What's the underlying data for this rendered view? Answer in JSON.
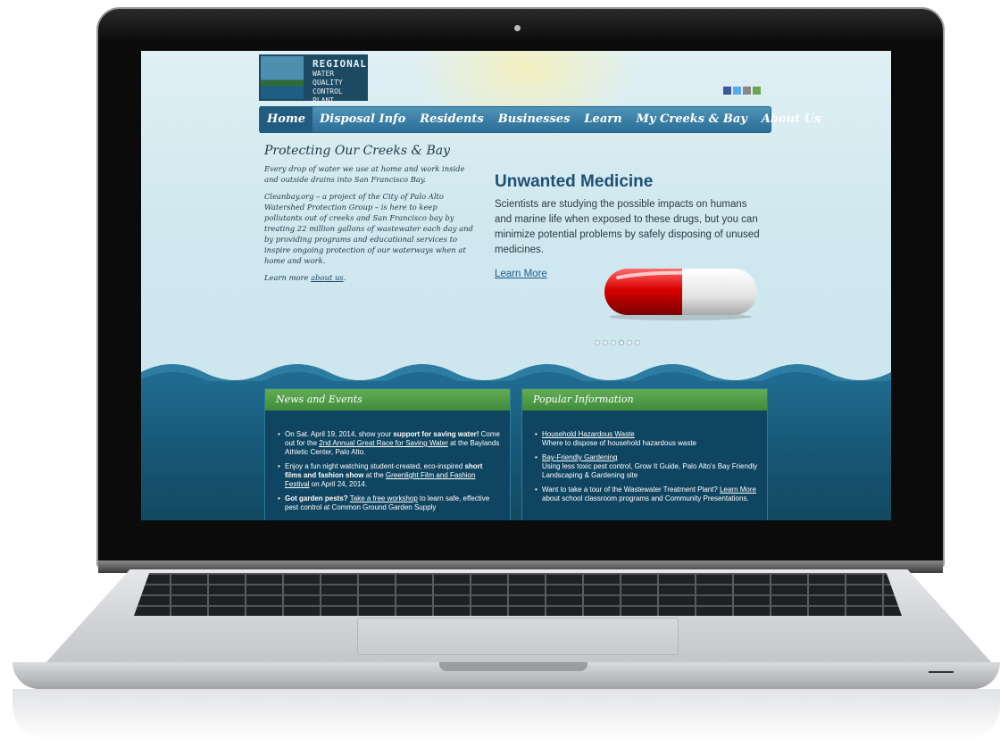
{
  "logo": {
    "line1": "REGIONAL",
    "line2": "WATER QUALITY",
    "line3": "CONTROL PLANT"
  },
  "nav": {
    "items": [
      "Home",
      "Disposal Info",
      "Residents",
      "Businesses",
      "Learn",
      "My Creeks & Bay",
      "About Us"
    ]
  },
  "social": {
    "icons": [
      "facebook-icon",
      "twitter-icon",
      "email-icon",
      "share-icon"
    ],
    "colors": [
      "#3b5998",
      "#55acee",
      "#888888",
      "#6aa84f"
    ]
  },
  "intro": {
    "title": "Protecting Our Creeks & Bay",
    "para1": "Every drop of water we use at home and work inside and outside drains into San Francisco Bay.",
    "para2": "Cleanbay.org – a project of the City of Palo Alto Watershed Protection Group – is here to keep pollutants out of creeks and San Francisco bay by treating 22 million gallons of wastewater each day and by providing programs and educational services to inspire ongoing protection of our waterways when at home and work.",
    "learn_prefix": "Learn more ",
    "learn_link": "about us",
    "learn_suffix": "."
  },
  "feature": {
    "title": "Unwanted Medicine",
    "body": "Scientists are studying the possible impacts on humans and marine life when exposed to these drugs, but you can minimize potential problems by safely disposing of unused medicines.",
    "link": "Learn More",
    "slides_total": 6,
    "slide_active": 4
  },
  "news": {
    "title": "News and Events",
    "items": [
      {
        "a": "On Sat. April 19, 2014, show your ",
        "b": "support for saving water!",
        "c": " Come out for the ",
        "link": "2nd Annual Great Race for Saving Water",
        "d": " at the Baylands Athletic Center, Palo Alto."
      },
      {
        "a": "Enjoy a fun night watching student-created, eco-inspired ",
        "b": "short films and fashion show",
        "c": " at the ",
        "link": "Greenlight Film and Fashion Festival",
        "d": " on April 24, 2014."
      },
      {
        "a": "",
        "b": "Got garden pests?",
        "c": " ",
        "link": "Take a free workshop",
        "d": " to learn safe, effective pest control at Common Ground Garden Supply"
      }
    ]
  },
  "popular": {
    "title": "Popular Information",
    "items": [
      {
        "link": "Household Hazardous Waste",
        "text": "Where to dispose of household hazardous waste"
      },
      {
        "link": "Bay-Friendly Gardening",
        "text": "Using less toxic pest control, Grow It Guide, Palo Alto's Bay Friendly Landscaping & Gardening site"
      },
      {
        "pre": "Want to take a tour of the Wastewater Treatment Plant? ",
        "link": "Learn More",
        "text": " about school classroom programs and Community Presentations."
      }
    ]
  }
}
